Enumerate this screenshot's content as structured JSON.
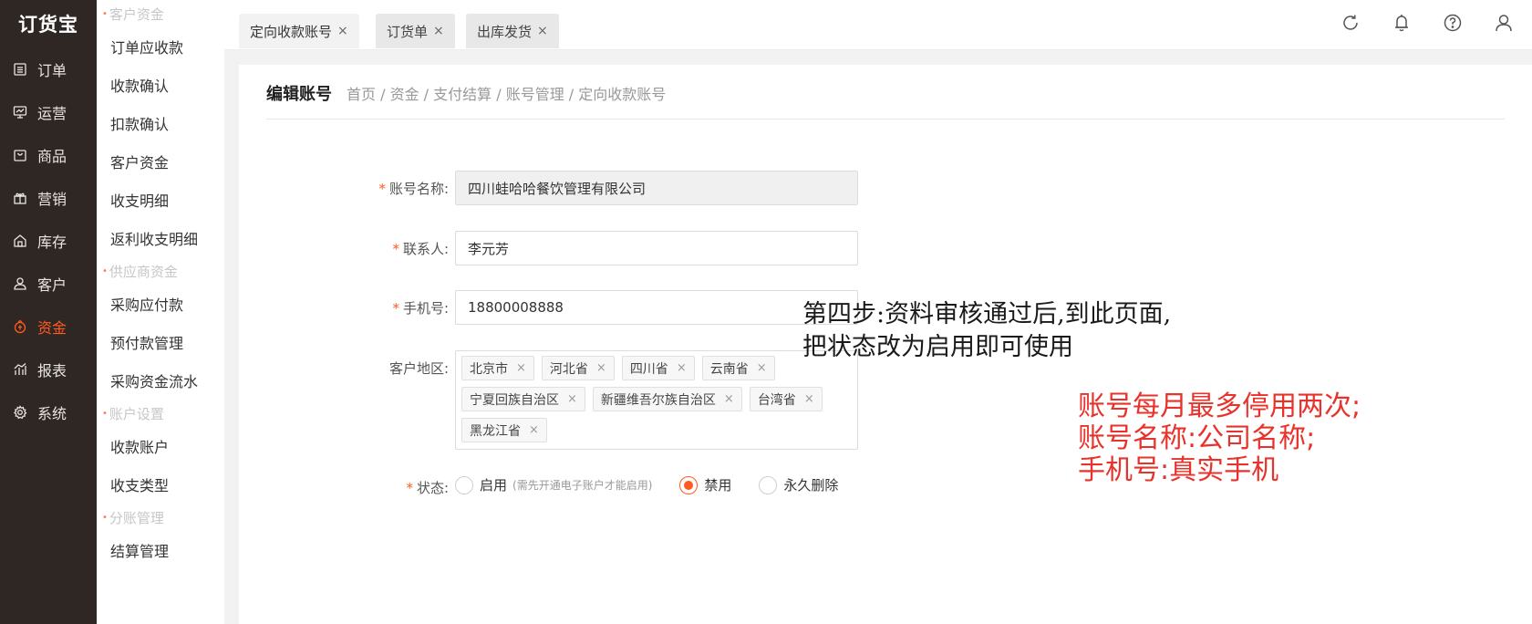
{
  "nav": {
    "logo": "订货宝",
    "items": [
      {
        "label": "订单",
        "icon": "list-icon"
      },
      {
        "label": "运营",
        "icon": "chart-board-icon"
      },
      {
        "label": "商品",
        "icon": "bag-icon"
      },
      {
        "label": "营销",
        "icon": "gift-icon"
      },
      {
        "label": "库存",
        "icon": "house-icon"
      },
      {
        "label": "客户",
        "icon": "people-icon"
      },
      {
        "label": "资金",
        "icon": "coin-icon",
        "active": true
      },
      {
        "label": "报表",
        "icon": "bar-chart-icon"
      },
      {
        "label": "系统",
        "icon": "gear-icon"
      }
    ],
    "active_color": "#ff5a1f"
  },
  "submenu": {
    "group1": "客户资金",
    "group1_items": [
      "订单应收款",
      "收款确认",
      "扣款确认",
      "客户资金",
      "收支明细",
      "返利收支明细"
    ],
    "group2": "供应商资金",
    "group2_items": [
      "采购应付款",
      "预付款管理",
      "采购资金流水"
    ],
    "group3": "账户设置",
    "group3_items": [
      "收款账户",
      "收支类型"
    ],
    "group4": "分账管理",
    "group4_items": [
      "结算管理"
    ]
  },
  "tabs": [
    {
      "label": "定向收款账号",
      "close": "×"
    },
    {
      "label": "订货单",
      "close": "×"
    },
    {
      "label": "出库发货",
      "close": "×"
    }
  ],
  "top_icons": [
    "refresh-icon",
    "bell-icon",
    "help-icon",
    "user-icon"
  ],
  "page": {
    "title": "编辑账号",
    "breadcrumb": "首页 / 资金 / 支付结算 / 账号管理 / 定向收款账号"
  },
  "form": {
    "required_mark": "*",
    "account_name_label": "账号名称:",
    "account_name_value": "四川蛙哈哈餐饮管理有限公司",
    "contact_label": "联系人:",
    "contact_value": "李元芳",
    "phone_label": "手机号:",
    "phone_value": "18800008888",
    "region_label": "客户地区:",
    "regions": [
      "北京市",
      "河北省",
      "四川省",
      "云南省",
      "宁夏回族自治区",
      "新疆维吾尔族自治区",
      "台湾省",
      "黑龙江省"
    ],
    "tag_close": "×",
    "status_label": "状态:",
    "status_enable": "启用",
    "status_enable_hint": "(需先开通电子账户才能启用)",
    "status_disable": "禁用",
    "status_delete": "永久删除",
    "status_selected": "禁用"
  },
  "annotations": {
    "black_line1": "第四步:资料审核通过后,到此页面,",
    "black_line2": "把状态改为启用即可使用",
    "red_line1": "账号每月最多停用两次;",
    "red_line2": "账号名称:公司名称;",
    "red_line3": "手机号:真实手机"
  }
}
